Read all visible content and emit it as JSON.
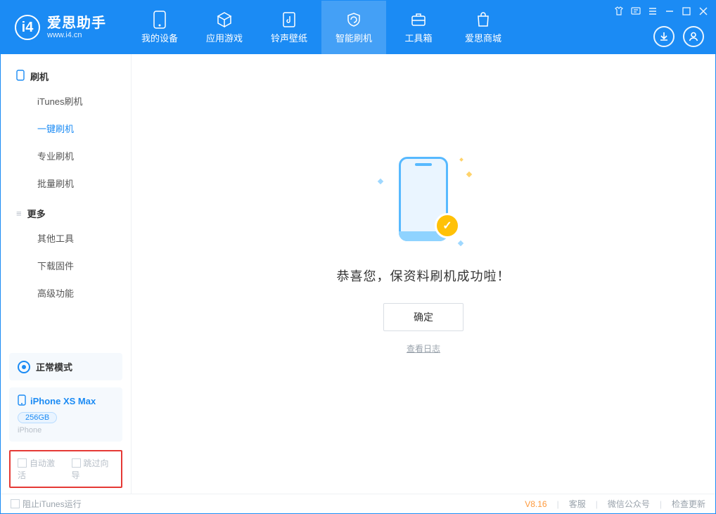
{
  "app": {
    "title": "爱思助手",
    "subtitle": "www.i4.cn"
  },
  "nav": {
    "device": "我的设备",
    "apps": "应用游戏",
    "ringtones": "铃声壁纸",
    "flash": "智能刷机",
    "toolbox": "工具箱",
    "store": "爱思商城"
  },
  "sidebar": {
    "flash_header": "刷机",
    "items": {
      "itunes": "iTunes刷机",
      "oneclick": "一键刷机",
      "pro": "专业刷机",
      "batch": "批量刷机"
    },
    "more_header": "更多",
    "more": {
      "other_tools": "其他工具",
      "download_fw": "下载固件",
      "advanced": "高级功能"
    }
  },
  "device": {
    "mode": "正常模式",
    "name": "iPhone XS Max",
    "storage": "256GB",
    "type": "iPhone"
  },
  "options": {
    "auto_activate": "自动激活",
    "skip_guide": "跳过向导"
  },
  "main": {
    "success_text": "恭喜您，保资料刷机成功啦！",
    "confirm": "确定",
    "view_log": "查看日志"
  },
  "footer": {
    "block_itunes": "阻止iTunes运行",
    "version": "V8.16",
    "support": "客服",
    "wechat": "微信公众号",
    "check_update": "检查更新"
  }
}
